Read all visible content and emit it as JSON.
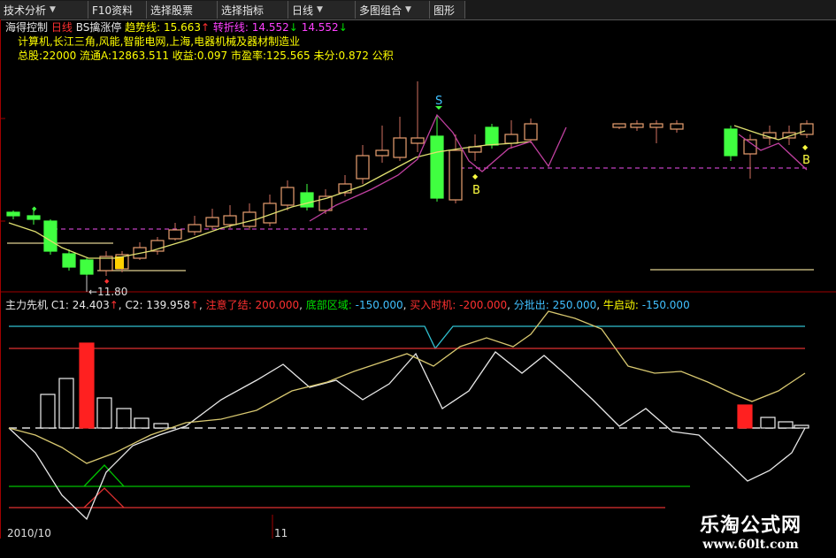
{
  "toolbar": {
    "buttons": [
      {
        "label": "技术分析",
        "arrow": "▼"
      },
      {
        "label": "F10资料",
        "arrow": ""
      },
      {
        "label": "选择股票",
        "arrow": ""
      },
      {
        "label": "选择指标",
        "arrow": ""
      },
      {
        "label": "日线",
        "arrow": "▼"
      },
      {
        "label": "多图组合",
        "arrow": "▼"
      },
      {
        "label": "图形",
        "arrow": ""
      }
    ]
  },
  "upper_panel": {
    "stock_name": "海得控制",
    "period": "日线",
    "indicator": "BS擒涨停",
    "trend_label": "趋势线:",
    "trend_value": "15.663",
    "trend_arrow": "↑",
    "turn_label": "转折线:",
    "turn_value": "14.552",
    "turn_arrow": "↓",
    "turn_value2": "14.552",
    "turn_arrow2": "↓",
    "concept_line": "计算机,长江三角,风能,智能电网,上海,电器机械及器材制造业",
    "stats_line": "总股:22000 流通A:12863.511 收益:0.097 市盈率:125.565 未分:0.872 公积",
    "low_price": "11.80",
    "sell_marker": "S",
    "buy_marker": "B"
  },
  "lower_panel": {
    "name": "主力先机",
    "c1_label": "C1:",
    "c1_value": "24.403",
    "c1_arrow": "↑",
    "c2_label": "C2:",
    "c2_value": "139.958",
    "c2_arrow": "↑",
    "attention_label": "注意了结:",
    "attention_value": "200.000",
    "bottom_label": "底部区域:",
    "bottom_value": "-150.000",
    "buy_label": "买入时机:",
    "buy_value": "-200.000",
    "distribute_label": "分批出:",
    "distribute_value": "250.000",
    "bull_label": "牛启动:",
    "bull_value": "-150.000"
  },
  "x_axis": {
    "left_date": "2010/10",
    "right_date": "11"
  },
  "watermark": {
    "title": "乐淘公式网",
    "url": "www.60lt.com"
  },
  "colors": {
    "background": "#000000",
    "up_candle": "#e8a070",
    "down_candle": "#40ff40",
    "trend_line": "#e0e070",
    "turn_line": "#c040a0",
    "axis_red": "#a00000"
  }
}
